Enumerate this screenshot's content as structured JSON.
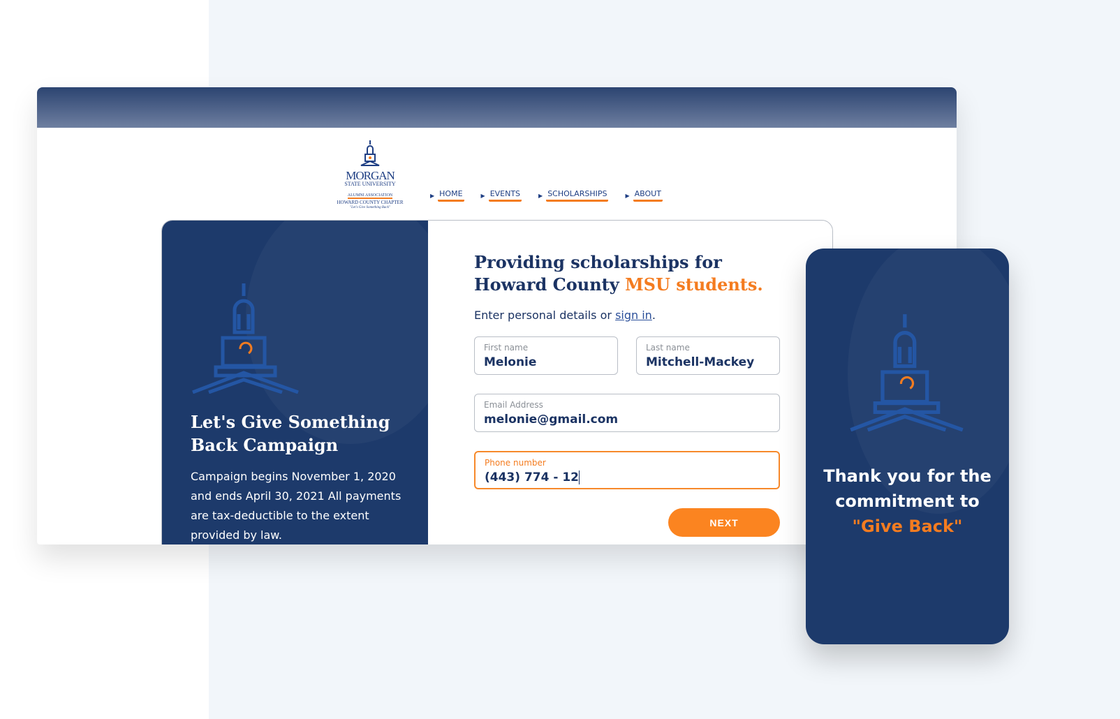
{
  "logo": {
    "line1": "MORGAN",
    "line2": "STATE UNIVERSITY",
    "line3": "ALUMNI ASSOCIATION",
    "line4": "HOWARD COUNTY CHAPTER",
    "tagline": "\"Let's Give Something Back\""
  },
  "nav": [
    {
      "label": "HOME"
    },
    {
      "label": "EVENTS"
    },
    {
      "label": "SCHOLARSHIPS"
    },
    {
      "label": "ABOUT"
    }
  ],
  "campaign": {
    "title": "Let's Give Something Back Campaign",
    "body": "Campaign begins November 1, 2020 and ends April 30, 2021 All payments are tax-deductible to the extent provided by law."
  },
  "form": {
    "heading": "Providing scholarships for Howard County ",
    "heading_accent": "MSU students.",
    "subtitle_pre": "Enter personal details or ",
    "signin": "sign in",
    "subtitle_post": ".",
    "first_name": {
      "label": "First name",
      "value": "Melonie"
    },
    "last_name": {
      "label": "Last name",
      "value": "Mitchell-Mackey"
    },
    "email": {
      "label": "Email Address",
      "value": "melonie@gmail.com"
    },
    "phone": {
      "label": "Phone number",
      "value": "(443) 774 - 12"
    },
    "next": "NEXT"
  },
  "mobile": {
    "line1": "Thank you for the commitment to",
    "accent": "\"Give Back\""
  },
  "colors": {
    "navy": "#1d3a6b",
    "orange": "#f47c20"
  }
}
